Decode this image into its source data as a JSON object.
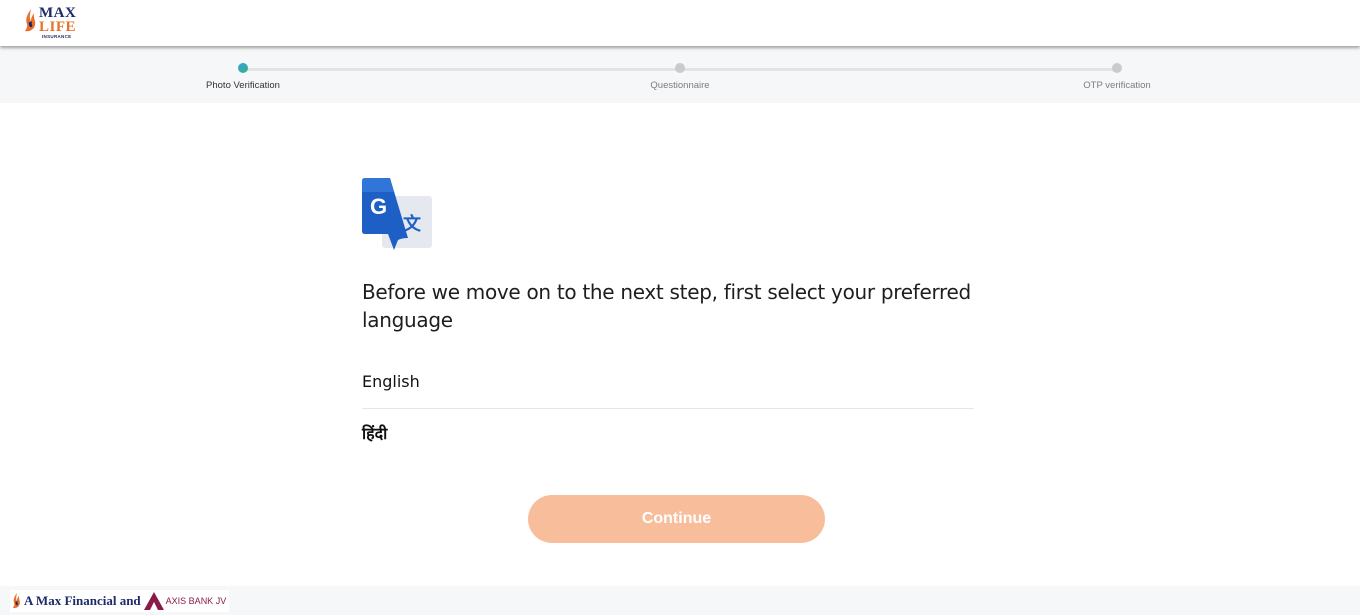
{
  "header": {
    "logo": {
      "line1": "MAX",
      "line2": "LIFE",
      "line3": "INSURANCE"
    }
  },
  "stepper": {
    "steps": [
      {
        "label": "Photo Verification",
        "active": true
      },
      {
        "label": "Questionnaire",
        "active": false
      },
      {
        "label": "OTP verification",
        "active": false
      }
    ]
  },
  "main": {
    "icon": "google-translate-icon",
    "prompt": "Before we move on to the next step, first select your preferred language",
    "languages": [
      {
        "label": "English"
      },
      {
        "label": "हिंदी"
      }
    ],
    "continue_label": "Continue"
  },
  "footer": {
    "brand_text": "A Max Financial and",
    "partner_text": "AXIS BANK JV"
  },
  "colors": {
    "accent": "#e8702a",
    "button_disabled": "#f8be9c",
    "brand_navy": "#1d2a6b",
    "axis_maroon": "#8a1c4a"
  }
}
